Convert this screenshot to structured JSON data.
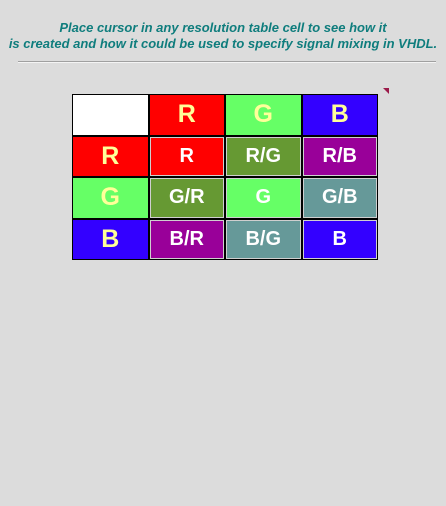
{
  "instructions": {
    "line1": "Place cursor in any resolution table cell to see how it",
    "line2": "is created and how it could be used to specify signal mixing in VHDL."
  },
  "table": {
    "col_headers": [
      "R",
      "G",
      "B"
    ],
    "row_headers": [
      "R",
      "G",
      "B"
    ],
    "cells": [
      [
        "R",
        "R/G",
        "R/B"
      ],
      [
        "G/R",
        "G",
        "G/B"
      ],
      [
        "B/R",
        "B/G",
        "B"
      ]
    ]
  },
  "colors": {
    "red": "#ff0000",
    "green": "#66ff66",
    "blue": "#3300ff",
    "red_green": "#669933",
    "red_blue": "#990099",
    "green_blue": "#669999",
    "header_text": "#ffff99",
    "instruction_text": "#0f7d7d"
  }
}
